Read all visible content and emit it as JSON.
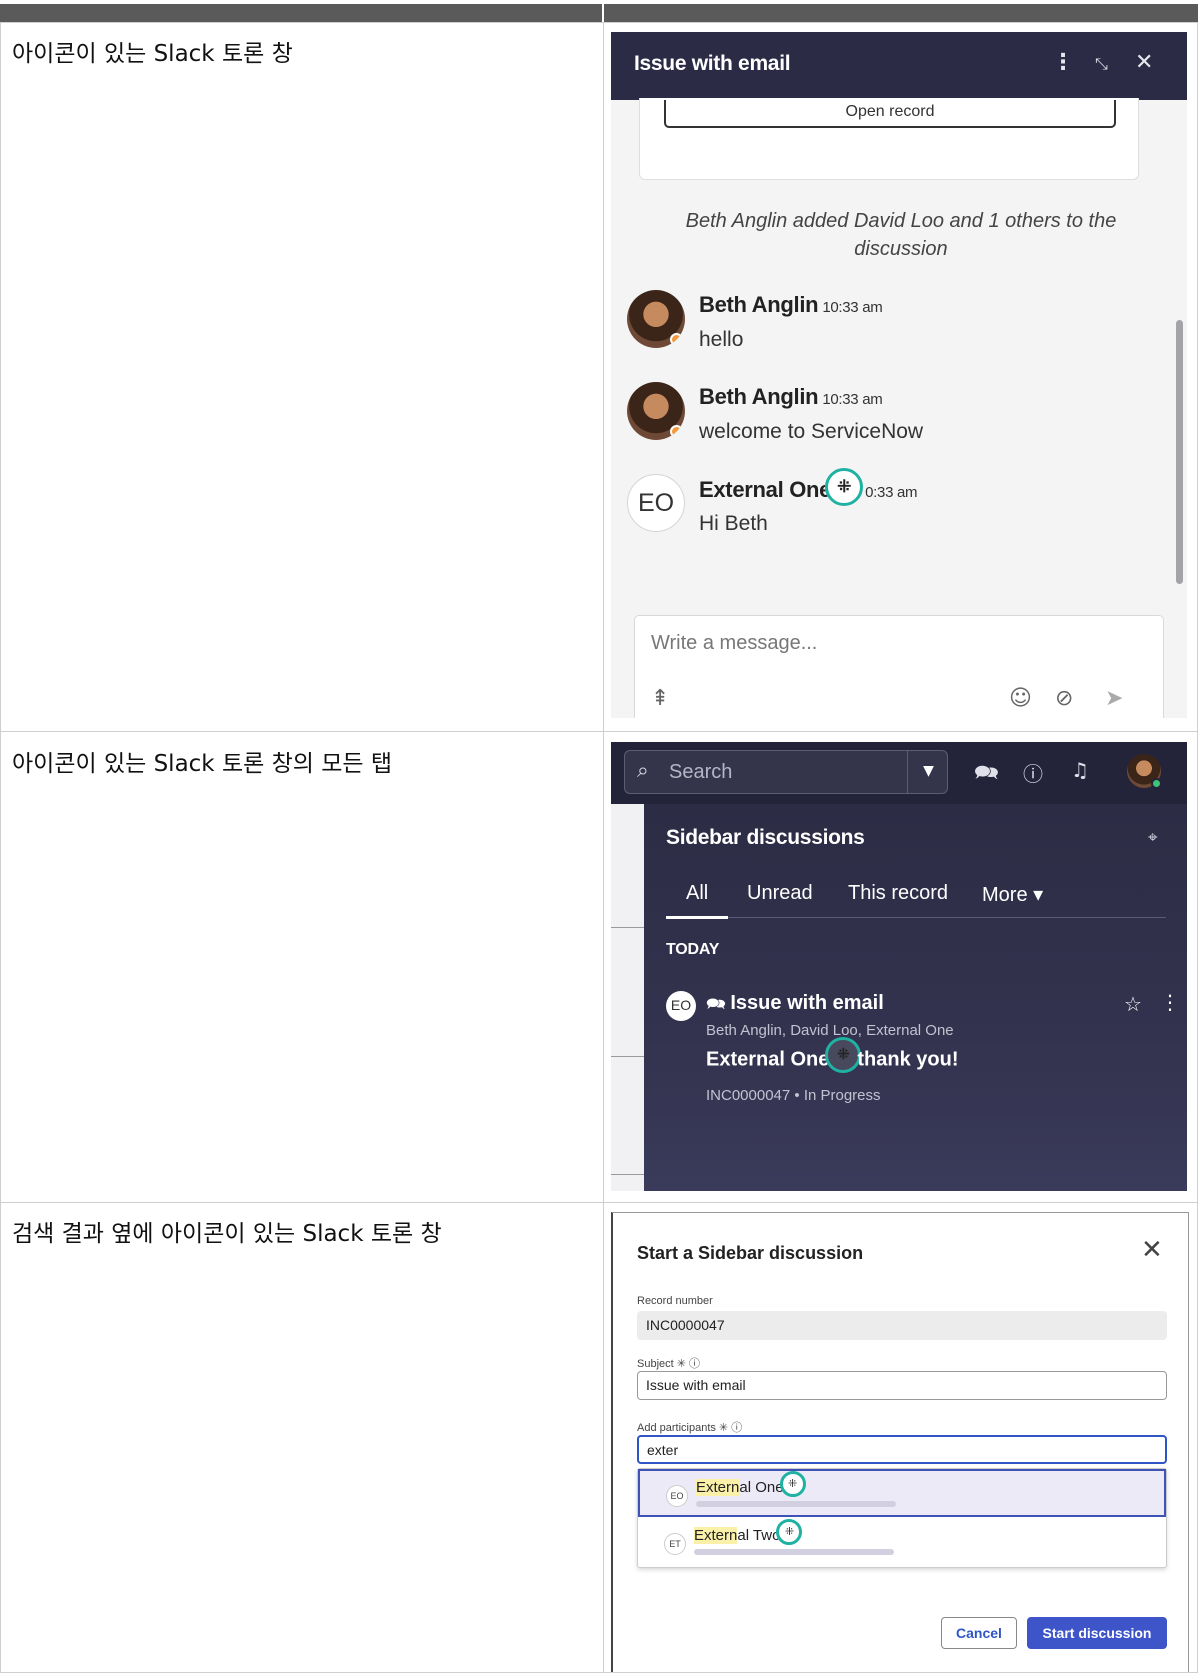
{
  "rows": [
    {
      "label": "아이콘이 있는 Slack 토론 창"
    },
    {
      "label": "아이콘이 있는 Slack 토론 창의 모든 탭"
    },
    {
      "label": "검색 결과 옆에 아이콘이 있는 Slack 토론 창"
    }
  ],
  "discussion": {
    "title": "Issue with email",
    "open_record": "Open record",
    "system_message": "Beth Anglin added David Loo and 1 others to the discussion",
    "messages": [
      {
        "author": "Beth Anglin",
        "time": "10:33 am",
        "text": "hello",
        "avatar": "photo"
      },
      {
        "author": "Beth Anglin",
        "time": "10:33 am",
        "text": "welcome to ServiceNow",
        "avatar": "photo"
      },
      {
        "author": "External One",
        "time": "10:33 am",
        "time_visible": "0:33 am",
        "text": "Hi Beth",
        "avatar": "EO"
      }
    ],
    "compose_placeholder": "Write a message...",
    "icons": [
      "kebab-icon",
      "minimize-icon",
      "close-icon",
      "mention-icon",
      "emoji-icon",
      "attach-icon",
      "send-icon"
    ]
  },
  "sidebar": {
    "search_placeholder": "Search",
    "title": "Sidebar discussions",
    "tabs": [
      "All",
      "Unread",
      "This record",
      "More ▾"
    ],
    "section": "TODAY",
    "item": {
      "avatar": "EO",
      "title": "Issue with email",
      "participants": "Beth Anglin, David Loo, External One",
      "last_author": "External One",
      "last_text": "thank you!",
      "meta": "INC0000047 • In Progress"
    },
    "icons": [
      "search-icon",
      "dropdown-icon",
      "discussions-icon",
      "help-icon",
      "bell-icon",
      "pin-icon",
      "star-icon"
    ]
  },
  "start_modal": {
    "title": "Start a Sidebar discussion",
    "record_label": "Record number",
    "record_value": "INC0000047",
    "subject_label": "Subject ✳ ⓘ",
    "subject_value": "Issue with email",
    "participants_label": "Add participants ✳ ⓘ",
    "participants_value": "exter",
    "options": [
      {
        "initials": "EO",
        "match": "Extern",
        "rest": "al One"
      },
      {
        "initials": "ET",
        "match": "Extern",
        "rest": "al Two"
      }
    ],
    "cancel": "Cancel",
    "start": "Start discussion"
  },
  "colors": {
    "accent_ring": "#1fb1a2",
    "header_dark": "#2b2b45",
    "primary_button": "#3d55c9"
  }
}
